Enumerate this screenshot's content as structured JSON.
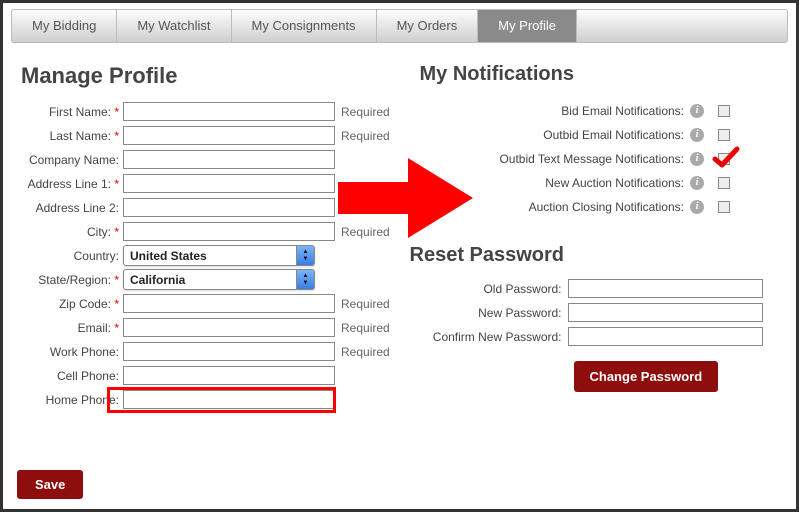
{
  "topnav": [
    {
      "label": "My Bidding"
    },
    {
      "label": "My Watchlist"
    },
    {
      "label": "My Consignments"
    },
    {
      "label": "My Orders"
    },
    {
      "label": "My Profile"
    }
  ],
  "titles": {
    "manageProfile": "Manage Profile",
    "myNotifications": "My Notifications",
    "resetPassword": "Reset Password"
  },
  "profile": {
    "requiredText": "Required",
    "fields": {
      "firstName": {
        "label": "First Name:"
      },
      "lastName": {
        "label": "Last Name:"
      },
      "companyName": {
        "label": "Company Name:"
      },
      "address1": {
        "label": "Address Line 1:"
      },
      "address2": {
        "label": "Address Line 2:"
      },
      "city": {
        "label": "City:"
      },
      "country": {
        "label": "Country:",
        "value": "United States"
      },
      "state": {
        "label": "State/Region:",
        "value": "California"
      },
      "zip": {
        "label": "Zip Code:"
      },
      "email": {
        "label": "Email:"
      },
      "workPhone": {
        "label": "Work Phone:"
      },
      "cellPhone": {
        "label": "Cell Phone:"
      },
      "homePhone": {
        "label": "Home Phone:"
      }
    }
  },
  "notifications": [
    {
      "label": "Bid Email Notifications:"
    },
    {
      "label": "Outbid Email Notifications:"
    },
    {
      "label": "Outbid Text Message Notifications:"
    },
    {
      "label": "New Auction Notifications:"
    },
    {
      "label": "Auction Closing Notifications:"
    }
  ],
  "password": {
    "old": "Old Password:",
    "new": "New Password:",
    "confirm": "Confirm New Password:"
  },
  "buttons": {
    "save": "Save",
    "changePassword": "Change Password"
  },
  "infoGlyph": "i"
}
